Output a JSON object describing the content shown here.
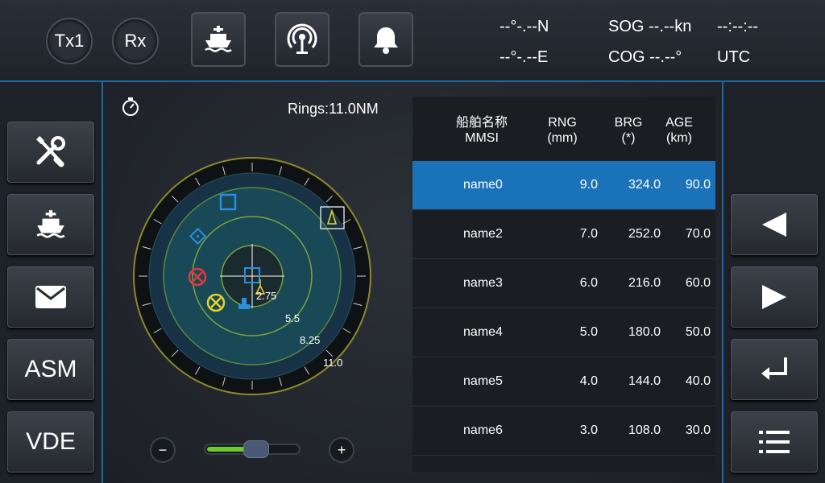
{
  "top": {
    "tx_label": "Tx1",
    "rx_label": "Rx",
    "lat": "--°-.--N",
    "lon": "--°-.--E",
    "sog": "SOG --.--kn",
    "cog": "COG --.--°",
    "time": "--:--:--",
    "tz": "UTC",
    "icons": [
      "ship-icon",
      "antenna-icon",
      "bell-icon"
    ]
  },
  "left_menu": {
    "items": [
      {
        "icon": "tools-icon",
        "label": ""
      },
      {
        "icon": "ship-icon",
        "label": ""
      },
      {
        "icon": "mail-icon",
        "label": ""
      },
      {
        "icon": "",
        "label": "ASM"
      },
      {
        "icon": "",
        "label": "VDE"
      }
    ]
  },
  "radar": {
    "rings_label": "Rings:11.0NM",
    "ring_labels": [
      "2.75",
      "5.5",
      "8.25",
      "11.0"
    ]
  },
  "table": {
    "headers": [
      {
        "l1": "船舶名称",
        "l2": "MMSI"
      },
      {
        "l1": "RNG",
        "l2": "(mm)"
      },
      {
        "l1": "BRG",
        "l2": "(*)"
      },
      {
        "l1": "AGE",
        "l2": "(km)"
      }
    ],
    "rows": [
      {
        "name": "name0",
        "rng": "9.0",
        "brg": "324.0",
        "age": "90.0",
        "selected": true
      },
      {
        "name": "name2",
        "rng": "7.0",
        "brg": "252.0",
        "age": "70.0",
        "selected": false
      },
      {
        "name": "name3",
        "rng": "6.0",
        "brg": "216.0",
        "age": "60.0",
        "selected": false
      },
      {
        "name": "name4",
        "rng": "5.0",
        "brg": "180.0",
        "age": "50.0",
        "selected": false
      },
      {
        "name": "name5",
        "rng": "4.0",
        "brg": "144.0",
        "age": "40.0",
        "selected": false
      },
      {
        "name": "name6",
        "rng": "3.0",
        "brg": "108.0",
        "age": "30.0",
        "selected": false
      }
    ]
  },
  "zoom": {
    "minus": "−",
    "plus": "+",
    "level": 0.55
  },
  "right_menu": {
    "icons": [
      "left-arrow-icon",
      "right-arrow-icon",
      "enter-icon",
      "list-icon"
    ]
  },
  "colors": {
    "accent": "#1a72b8",
    "border": "#1e6aa3"
  }
}
